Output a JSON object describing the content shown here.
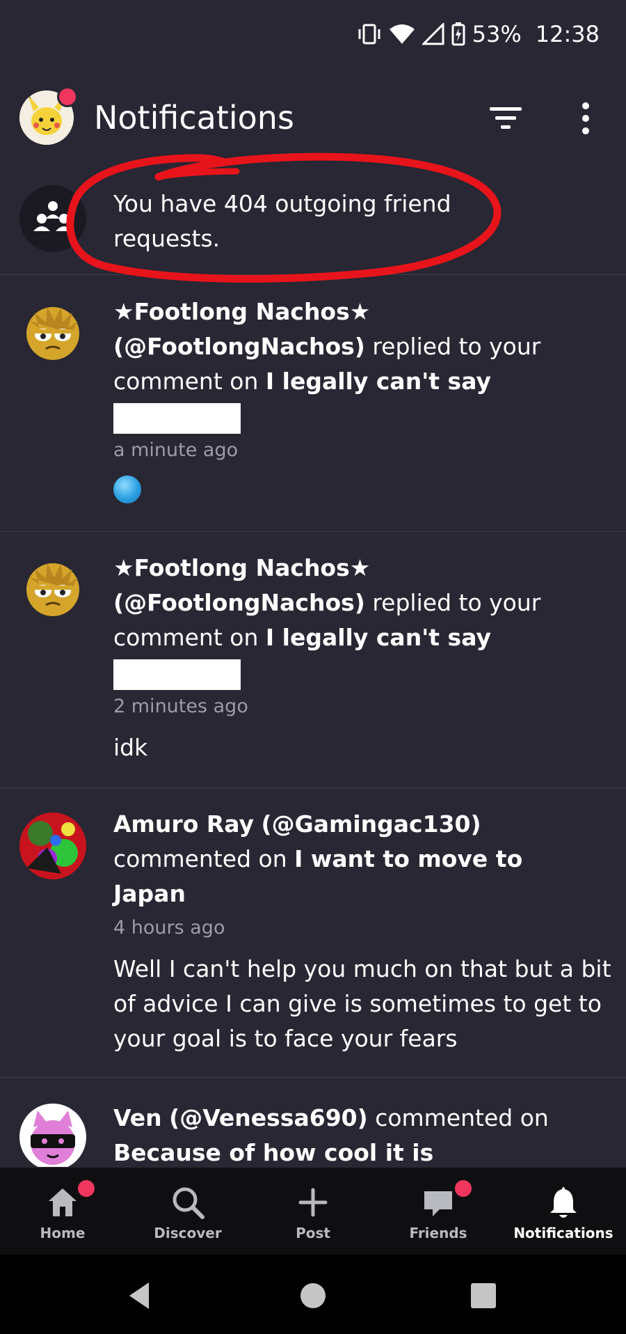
{
  "status_bar": {
    "battery": "53%",
    "time": "12:38"
  },
  "header": {
    "title": "Notifications"
  },
  "friend_requests": {
    "text": "You have 404 outgoing friend requests."
  },
  "notifications": [
    {
      "user": "★Footlong Nachos★",
      "handle": "(@FootlongNachos)",
      "action": "replied to your comment on",
      "post": "I legally can't say",
      "time": "a minute ago",
      "comment": ""
    },
    {
      "user": "★Footlong Nachos★",
      "handle": "(@FootlongNachos)",
      "action": "replied to your comment on",
      "post": "I legally can't say",
      "time": "2 minutes ago",
      "comment": "idk"
    },
    {
      "user": "Amuro Ray",
      "handle": "(@Gamingac130)",
      "action": "commented on",
      "post": "I want to move to Japan",
      "time": "4 hours ago",
      "comment": "Well I can't help you much on that but a bit of advice I can give is sometimes to get to your goal is to face your fears"
    },
    {
      "user": "Ven",
      "handle": "(@Venessa690)",
      "action": "commented on",
      "post": "Because of how cool it is",
      "time": "",
      "comment": ""
    }
  ],
  "bottom_nav": {
    "home": "Home",
    "discover": "Discover",
    "post": "Post",
    "friends": "Friends",
    "notifications": "Notifications"
  },
  "colors": {
    "background": "#282733",
    "badge": "#f0365e",
    "annotation": "#e8141b"
  }
}
